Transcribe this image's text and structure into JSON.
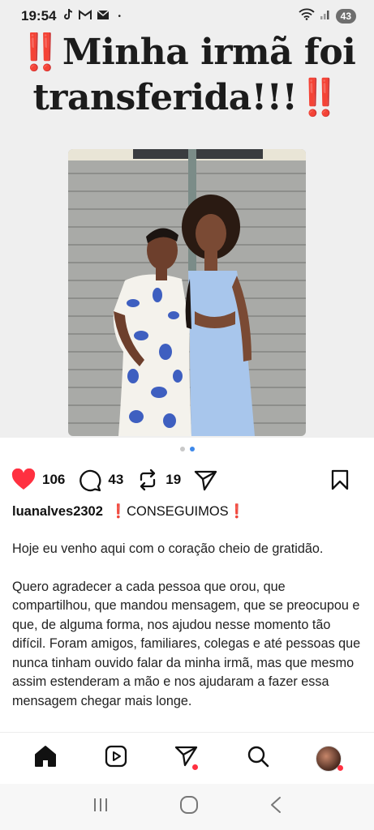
{
  "status_bar": {
    "time": "19:54",
    "notification_icons": [
      "tiktok-icon",
      "gmail-icon",
      "mail-icon"
    ],
    "dot": "•",
    "battery": "43"
  },
  "post": {
    "headline": {
      "marks": "‼️",
      "line1": "Minha irmã foi",
      "line2": "transferida!!!"
    },
    "carousel": {
      "count": 2,
      "active_index": 1
    },
    "likes": "106",
    "comments": "43",
    "reposts": "19",
    "username": "luanalves2302",
    "caption_title": "CONSEGUIMOS",
    "caption_mark": "❗",
    "paragraph1": "Hoje eu venho aqui com o coração cheio de gratidão.",
    "paragraph2": "Quero agradecer a cada pessoa que orou, que compartilhou, que mandou mensagem, que se preocupou e que, de alguma forma, nos ajudou nesse momento tão difícil. Foram amigos, familiares, colegas e até pessoas que nunca tinham ouvido falar da minha irmã, mas que mesmo assim estenderam a mão e nos ajudaram a fazer essa mensagem chegar mais longe."
  },
  "bottom_nav": [
    "home-icon",
    "reels-icon",
    "send-icon",
    "search-icon",
    "profile-avatar"
  ],
  "system_nav": [
    "recents-icon",
    "home-circle-icon",
    "back-icon"
  ],
  "colors": {
    "like_red": "#ff3040",
    "accent_red": "#e0201c",
    "dot_blue": "#3d88ea"
  }
}
